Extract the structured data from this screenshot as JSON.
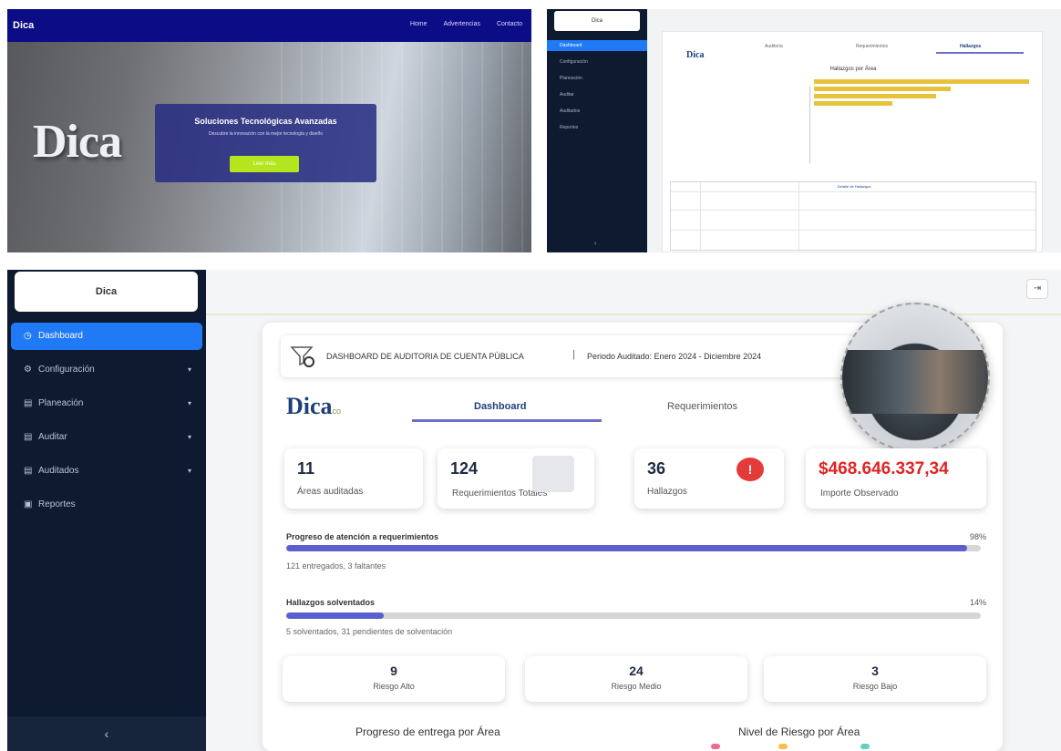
{
  "colors": {
    "accent": "#2079f5",
    "sidebar": "#0d1a2f",
    "progress": "#5b5fcf",
    "alert": "#e02424",
    "cta": "#b5e61d",
    "bar": "#e8c23a"
  },
  "panel1": {
    "logo": "Dica",
    "nav": [
      "Home",
      "Advertencias",
      "Contacto"
    ],
    "big_word": "Dica",
    "card_title": "Soluciones Tecnológicas Avanzadas",
    "card_subtitle": "Descubre la innovación con la mejor tecnología y diseño",
    "card_button": "Leer más"
  },
  "panel2": {
    "brand": "Dica",
    "menu": [
      "Dashboard",
      "Configuración",
      "Planeación",
      "Auditar",
      "Auditados",
      "Reportes"
    ],
    "collapse": "‹",
    "logo": "Dica",
    "tabs": [
      "Auditoria",
      "Requerimientos",
      "Hallazgos"
    ],
    "chart_title": "Hallazgos por Área",
    "table_header": "Detalle de Hallazgos"
  },
  "panel3": {
    "brand": "Dica",
    "sidebar": [
      {
        "icon": "dashboard-icon",
        "glyph": "◷",
        "label": "Dashboard",
        "chev": ""
      },
      {
        "icon": "gear-icon",
        "glyph": "⚙",
        "label": "Configuración",
        "chev": "▾"
      },
      {
        "icon": "calendar-icon",
        "glyph": "▤",
        "label": "Planeación",
        "chev": "▾"
      },
      {
        "icon": "calendar-icon",
        "glyph": "▤",
        "label": "Auditar",
        "chev": "▾"
      },
      {
        "icon": "calendar-icon",
        "glyph": "▤",
        "label": "Auditados",
        "chev": "▾"
      },
      {
        "icon": "report-icon",
        "glyph": "▣",
        "label": "Reportes",
        "chev": ""
      }
    ],
    "collapse": "‹",
    "export_glyph": "⇥",
    "header_title": "DASHBOARD DE AUDITORIA DE CUENTA PÚBLICA",
    "header_sep": "|",
    "header_period": "Periodo Auditado: Enero 2024 - Diciembre 2024",
    "logo": "Dica",
    "logo_sub": "co",
    "tabs": [
      "Dashboard",
      "Requerimientos"
    ],
    "kpis": [
      {
        "value": "11",
        "label": "Áreas auditadas"
      },
      {
        "value": "124",
        "label": "Requerimientos Totales"
      },
      {
        "value": "36",
        "label": "Hallazgos"
      },
      {
        "value": "$468.646.337,34",
        "label": "Importe Observado"
      }
    ],
    "progress_requerimientos": {
      "label": "Progreso de atención a requerimientos",
      "pct_text": "98%",
      "fraction": 0.98,
      "sub": "121 entregados, 3 faltantes"
    },
    "progress_hallazgos": {
      "label": "Hallazgos solventados",
      "pct_text": "14%",
      "fraction": 0.14,
      "sub": "5 solventados, 31 pendientes de solventación"
    },
    "risks": [
      {
        "value": "9",
        "label": "Riesgo Alto"
      },
      {
        "value": "24",
        "label": "Riesgo Medio"
      },
      {
        "value": "3",
        "label": "Riesgo Bajo"
      }
    ],
    "section_left": "Progreso de entrega por Área",
    "section_right": "Nivel de Riesgo por Área"
  }
}
